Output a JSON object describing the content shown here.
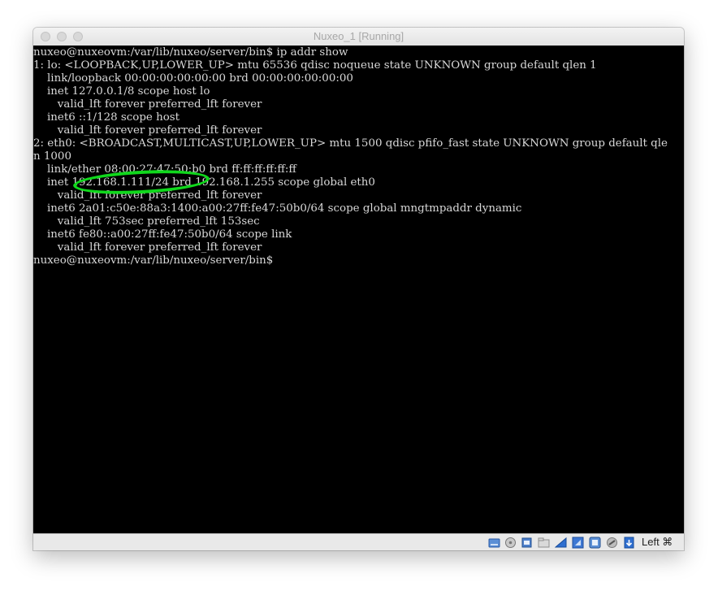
{
  "window": {
    "title": "Nuxeo_1 [Running]"
  },
  "terminal": {
    "lines": [
      "nuxeo@nuxeovm:/var/lib/nuxeo/server/bin$ ip addr show",
      "1: lo: <LOOPBACK,UP,LOWER_UP> mtu 65536 qdisc noqueue state UNKNOWN group default qlen 1",
      "    link/loopback 00:00:00:00:00:00 brd 00:00:00:00:00:00",
      "    inet 127.0.0.1/8 scope host lo",
      "       valid_lft forever preferred_lft forever",
      "    inet6 ::1/128 scope host",
      "       valid_lft forever preferred_lft forever",
      "2: eth0: <BROADCAST,MULTICAST,UP,LOWER_UP> mtu 1500 qdisc pfifo_fast state UNKNOWN group default qle",
      "n 1000",
      "    link/ether 08:00:27:47:50:b0 brd ff:ff:ff:ff:ff:ff",
      "    inet 192.168.1.111/24 brd 192.168.1.255 scope global eth0",
      "       valid_lft forever preferred_lft forever",
      "    inet6 2a01:c50e:88a3:1400:a00:27ff:fe47:50b0/64 scope global mngtmpaddr dynamic",
      "       valid_lft 753sec preferred_lft 153sec",
      "    inet6 fe80::a00:27ff:fe47:50b0/64 scope link",
      "       valid_lft forever preferred_lft forever",
      "nuxeo@nuxeovm:/var/lib/nuxeo/server/bin$"
    ],
    "highlight_color": "#10d81c"
  },
  "statusbar": {
    "icons": [
      "hard-disk-icon",
      "optical-drive-icon",
      "usb-icon",
      "shared-folder-icon",
      "display-icon",
      "network-icon",
      "video-capture-icon",
      "cpu-icon",
      "mouse-integration-icon",
      "host-key-arrow-icon"
    ],
    "host_key": "Left ⌘"
  }
}
